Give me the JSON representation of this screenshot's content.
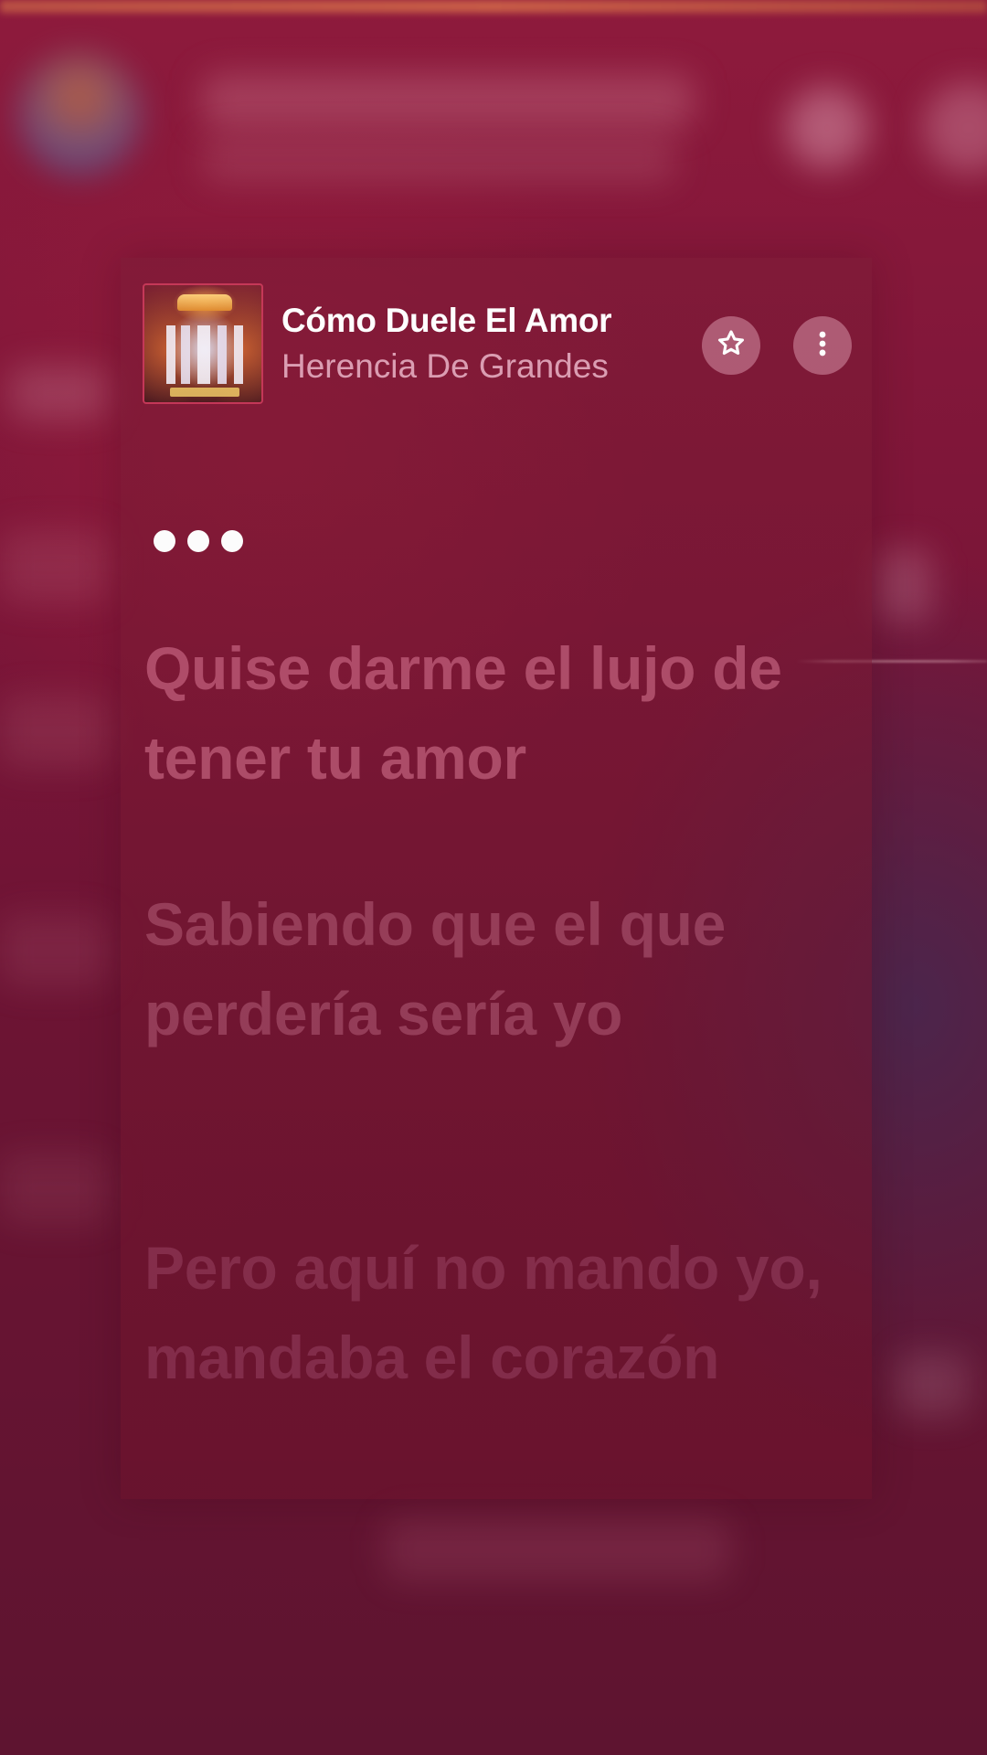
{
  "now_playing": {
    "title": "Cómo Duele El Amor",
    "artist": "Herencia De Grandes",
    "album_art_icon": "album-art",
    "favorite_icon": "star-icon",
    "more_icon": "more-vertical-icon"
  },
  "lyrics": {
    "instrumental_indicator": "•••",
    "lines": [
      "Quise darme el lujo de tener tu amor",
      "Sabiendo que el que perdería sería yo",
      "Pero aquí no mando yo, mandaba el corazón"
    ]
  },
  "colors": {
    "background": "#7a1538",
    "card": "#78142f",
    "accent_border": "#c43455",
    "title": "#ffffff",
    "artist": "#ebb4c8"
  }
}
